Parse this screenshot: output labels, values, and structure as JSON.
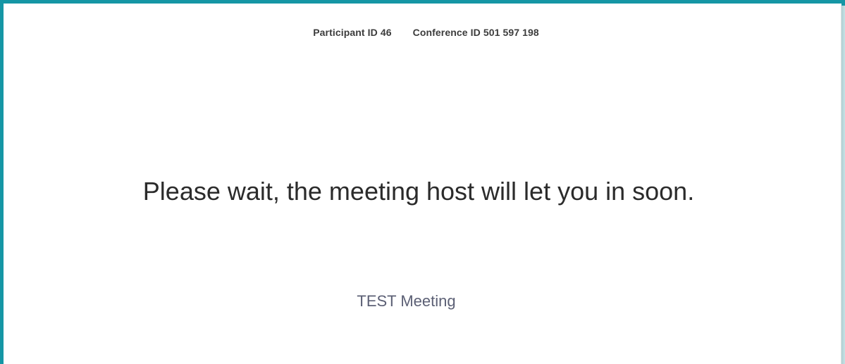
{
  "header": {
    "participant_id": "Participant ID 46",
    "conference_id": "Conference ID 501 597 198"
  },
  "main": {
    "wait_message": "Please wait, the meeting host will let you in soon.",
    "meeting_name": "TEST Meeting"
  },
  "colors": {
    "frame_border": "#1596a5",
    "text_dark": "#2b2b2b",
    "meeting_name_text": "#5c6075"
  }
}
